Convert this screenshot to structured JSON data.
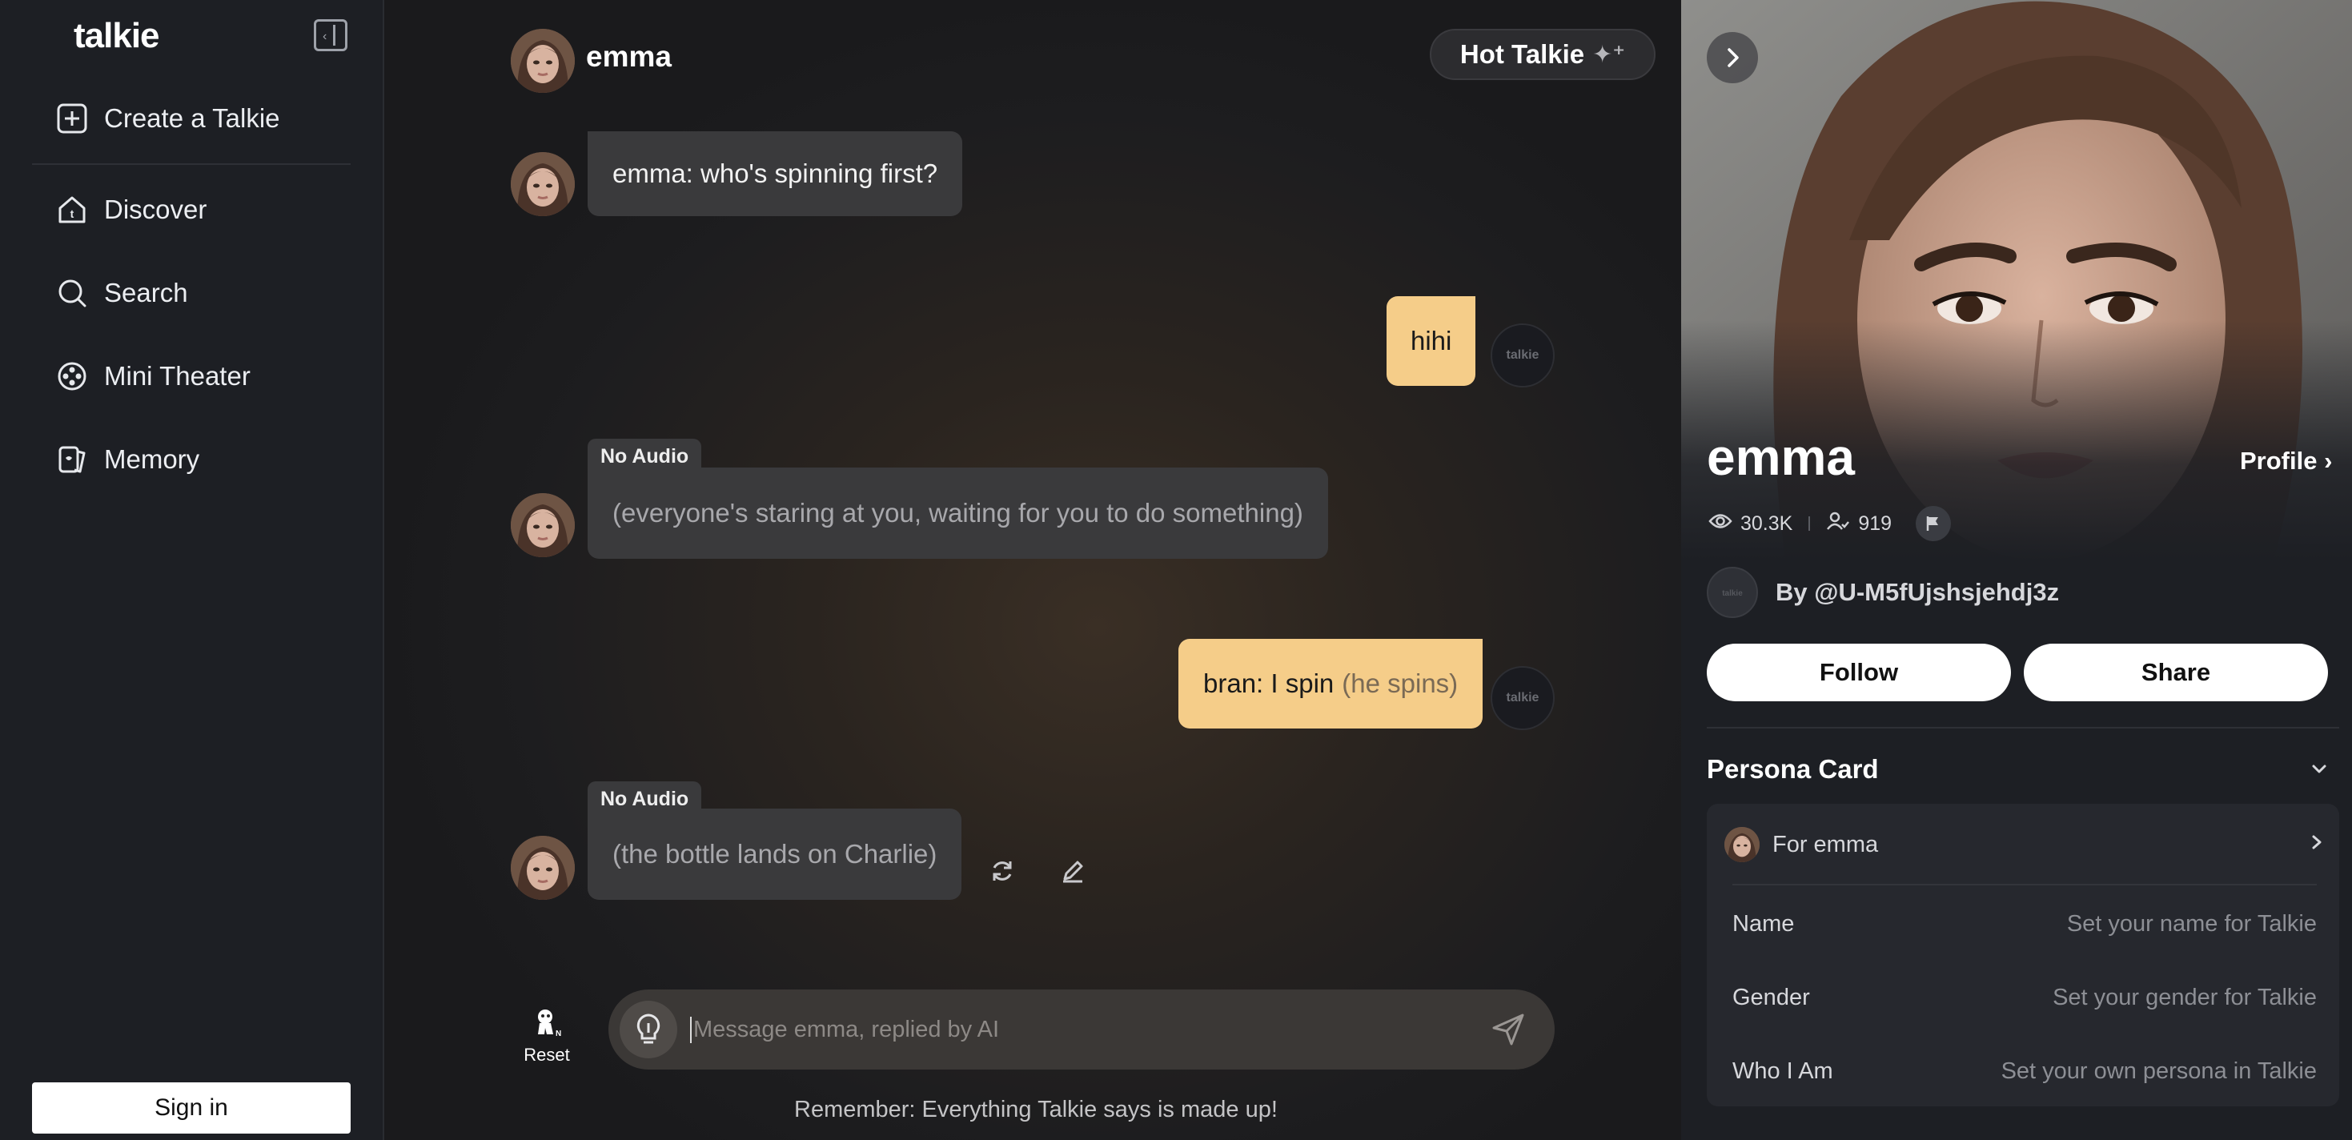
{
  "sidebar": {
    "logo": "talkie",
    "items": [
      {
        "label": "Create a Talkie",
        "icon": "plus-square-icon"
      },
      {
        "label": "Discover",
        "icon": "home-icon"
      },
      {
        "label": "Search",
        "icon": "search-icon"
      },
      {
        "label": "Mini Theater",
        "icon": "film-reel-icon"
      },
      {
        "label": "Memory",
        "icon": "memory-cards-icon"
      }
    ],
    "sign_in": "Sign in"
  },
  "chat": {
    "character_name": "emma",
    "hot_button": "Hot Talkie",
    "messages": [
      {
        "role": "ai",
        "text": "emma: who's spinning first?"
      },
      {
        "role": "user",
        "text": "hihi"
      },
      {
        "role": "ai",
        "badge": "No Audio",
        "text": "(everyone's staring at you, waiting for you to do something)"
      },
      {
        "role": "user",
        "text": "bran: I spin",
        "aside": "(he spins)"
      },
      {
        "role": "ai",
        "badge": "No Audio",
        "text": "(the bottle lands on Charlie)"
      }
    ],
    "user_avatar_text": "talkie",
    "reset_label": "Reset",
    "input_placeholder": "Message emma, replied by AI",
    "disclaimer": "Remember: Everything Talkie says is made up!"
  },
  "panel": {
    "name": "emma",
    "profile_link": "Profile",
    "views": "30.3K",
    "followers": "919",
    "creator": "By @U-M5fUjshsjehdj3z",
    "follow": "Follow",
    "share": "Share",
    "persona_card": {
      "title": "Persona Card",
      "for_label": "For emma",
      "rows": [
        {
          "label": "Name",
          "value": "Set your name for Talkie"
        },
        {
          "label": "Gender",
          "value": "Set your gender for Talkie"
        },
        {
          "label": "Who I Am",
          "value": "Set your own persona in Talkie"
        }
      ]
    }
  },
  "colors": {
    "user_bubble": "#f5cd89",
    "ai_bubble": "#3a3a3c",
    "sidebar_bg": "#1d1f24"
  }
}
